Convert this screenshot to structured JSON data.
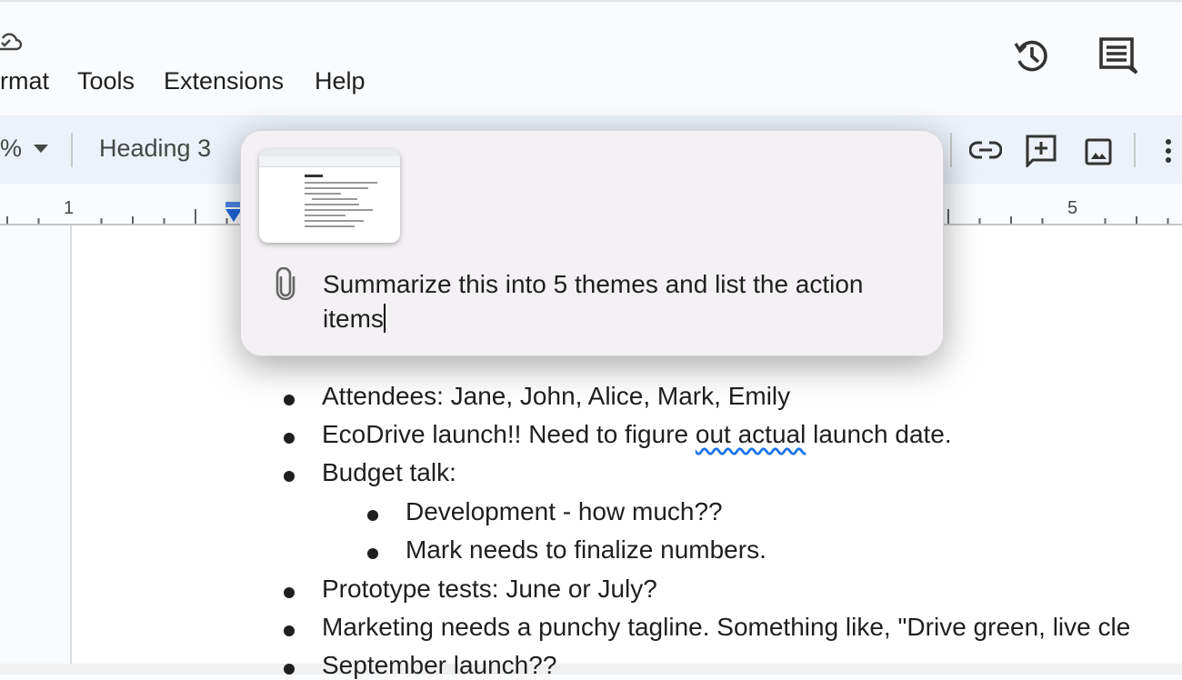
{
  "menubar": {
    "items": [
      "rmat",
      "Tools",
      "Extensions",
      "Help"
    ],
    "icons": [
      "cloud-saved-icon",
      "version-history-icon",
      "comments-icon"
    ]
  },
  "toolbar": {
    "zoom_partial": "%",
    "style": "Heading 3",
    "icons": [
      "insert-link-icon",
      "add-comment-icon",
      "insert-image-icon",
      "more-options-icon"
    ]
  },
  "ruler": {
    "labels": [
      "1",
      "5"
    ]
  },
  "popup": {
    "attachment": "document-screenshot-thumbnail",
    "prompt": "Summarize this into 5 themes and list the action items"
  },
  "document": {
    "items": [
      {
        "level": 1,
        "text": "Attendees: Jane, John, Alice, Mark, Emily"
      },
      {
        "level": 1,
        "text": "EcoDrive launch!! Need to figure out actual launch date.",
        "spellcheck": "out actual"
      },
      {
        "level": 1,
        "text": "Budget talk:"
      },
      {
        "level": 2,
        "text": "Development - how much??"
      },
      {
        "level": 2,
        "text": "Mark needs to finalize numbers."
      },
      {
        "level": 1,
        "text": "Prototype tests: June or July?"
      },
      {
        "level": 1,
        "text": "Marketing needs a punchy tagline. Something like, \"Drive green, live cle"
      },
      {
        "level": 1,
        "text": "September launch??"
      }
    ]
  },
  "colors": {
    "accent": "#0b57d0",
    "toolbar_bg": "#edf2fa",
    "popup_bg": "#f3f1f3"
  }
}
